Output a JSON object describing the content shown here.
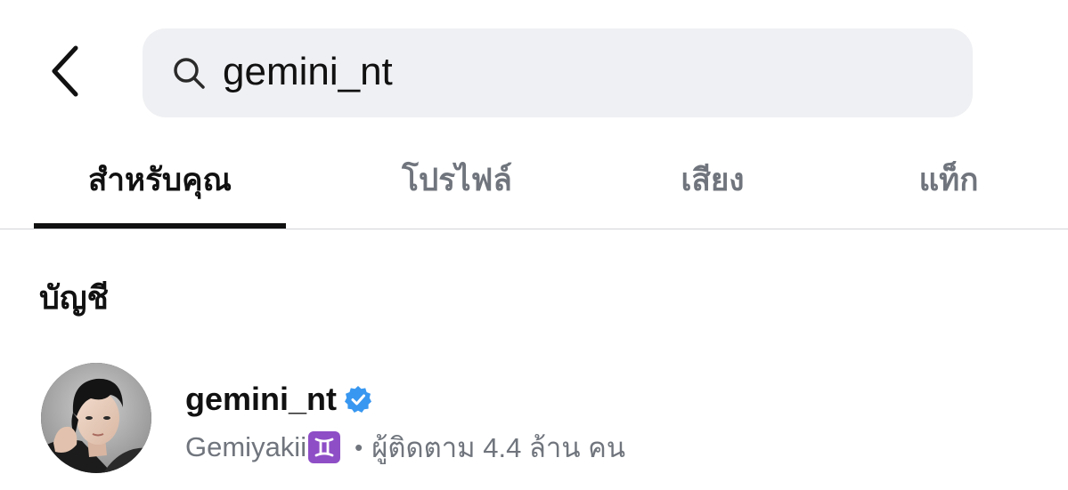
{
  "header": {
    "back_icon": "chevron-left-icon",
    "search": {
      "icon": "search-icon",
      "value": "gemini_nt"
    }
  },
  "tabs": [
    {
      "label": "สำหรับคุณ",
      "active": true
    },
    {
      "label": "โปรไฟล์",
      "active": false
    },
    {
      "label": "เสียง",
      "active": false
    },
    {
      "label": "แท็ก",
      "active": false
    }
  ],
  "section": {
    "title": "บัญชี"
  },
  "account": {
    "username": "gemini_nt",
    "verified": true,
    "verified_icon": "verified-badge-icon",
    "display_name": "Gemiyakii",
    "zodiac_icon": "gemini-zodiac-icon",
    "separator": "•",
    "followers_text": "ผู้ติดตาม 4.4 ล้าน คน"
  },
  "colors": {
    "search_bg": "#eff0f3",
    "inactive_tab": "#70757d",
    "verified_blue": "#3897f0",
    "zodiac_purple": "#8e4ec6"
  }
}
